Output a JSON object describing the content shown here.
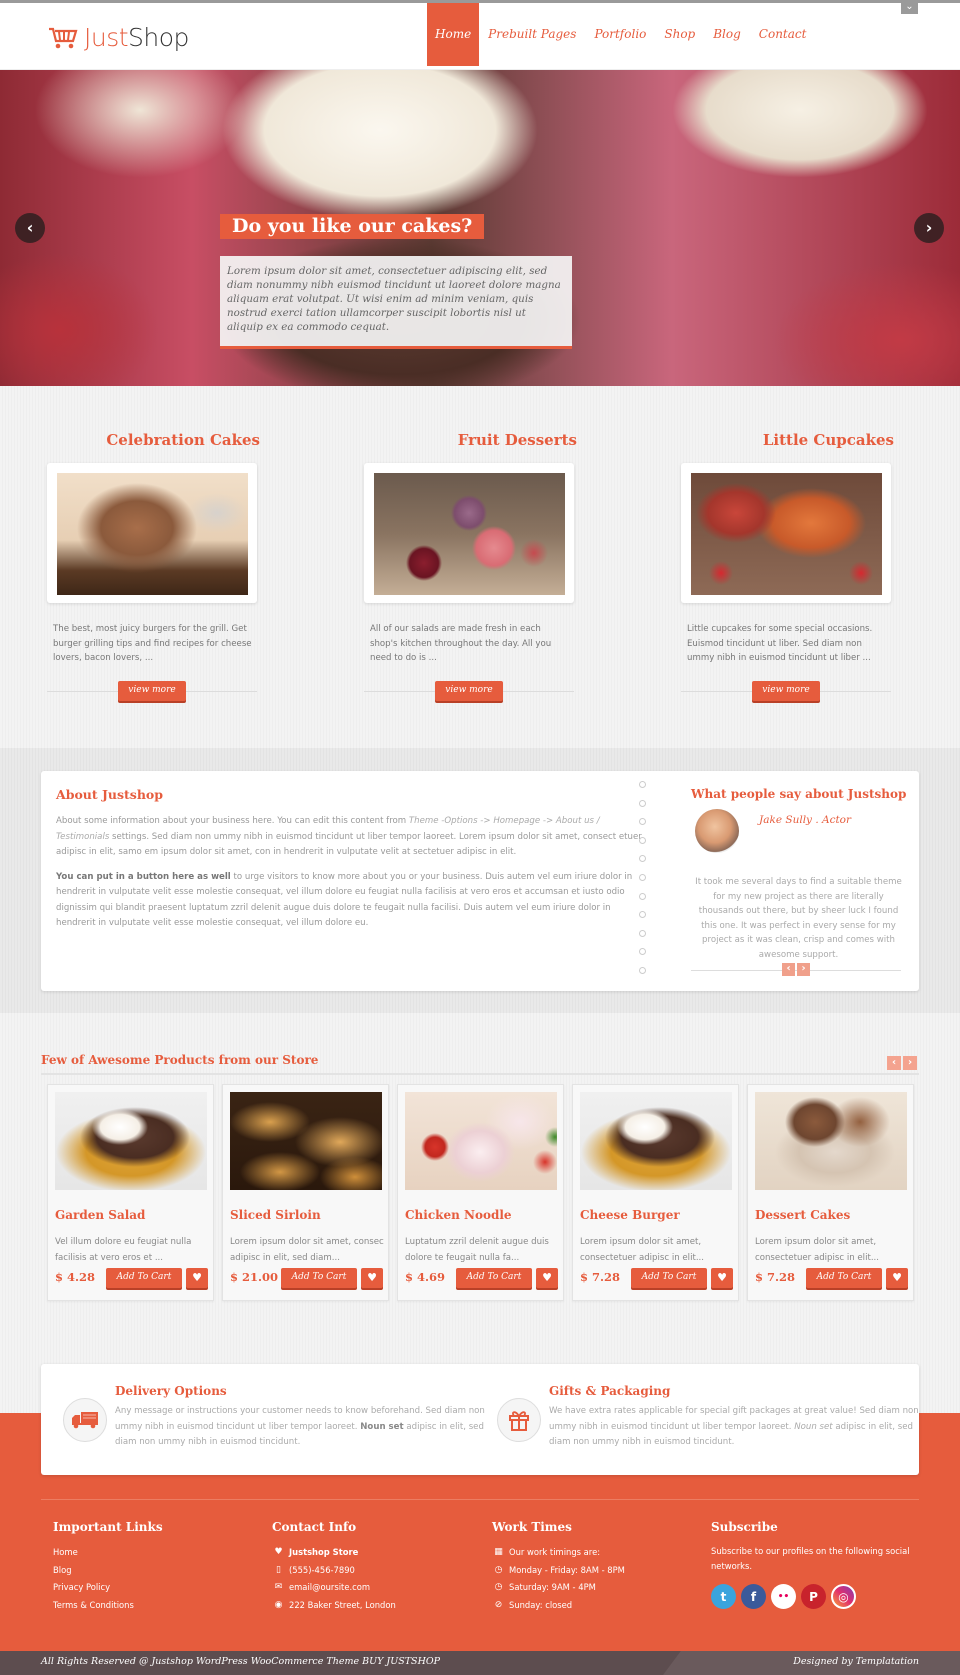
{
  "header": {
    "logo": {
      "part1": "Just",
      "part2": "Shop"
    },
    "nav": [
      {
        "label": "Home",
        "active": true
      },
      {
        "label": "Prebuilt Pages",
        "active": false
      },
      {
        "label": "Portfolio",
        "active": false
      },
      {
        "label": "Shop",
        "active": false
      },
      {
        "label": "Blog",
        "active": false
      },
      {
        "label": "Contact",
        "active": false
      }
    ],
    "toggle_icon": "chevron-down-icon"
  },
  "hero": {
    "title": "Do you like our cakes?",
    "text": "Lorem ipsum dolor sit amet, consectetuer adipiscing elit, sed diam nonummy nibh euismod tincidunt ut laoreet dolore magna aliquam erat volutpat. Ut wisi enim ad minim veniam, quis nostrud exerci tation ullamcorper suscipit lobortis nisl ut aliquip ex ea commodo cequat.",
    "prev_icon": "‹",
    "next_icon": "›"
  },
  "features": [
    {
      "title": "Celebration Cakes",
      "text": "The best, most juicy burgers for the grill. Get burger grilling tips and find recipes for cheese lovers, bacon lovers, ...",
      "button": "view more"
    },
    {
      "title": "Fruit Desserts",
      "text": "All of our salads are made fresh in each shop's kitchen throughout the day. All you need to do is ...",
      "button": "view more"
    },
    {
      "title": "Little Cupcakes",
      "text": "Little cupcakes for some special occasions. Euismod tincidunt ut liber. Sed diam non ummy nibh in euismod tincidunt ut liber ...",
      "button": "view more"
    }
  ],
  "about": {
    "title": "About Justshop",
    "p1_start": "About some information about your business here. You can edit this content from ",
    "p1_italic": "Theme -Options -> Homepage -> About us / Testimonials",
    "p1_end": " settings. Sed diam non ummy nibh in euismod tincidunt ut liber tempor laoreet. Lorem ipsum dolor sit amet, consect etuer adipisc in elit, samo em ipsum dolor sit amet, con in hendrerit in vulputate velit at sectetuer adipisc in elit.",
    "p2_bold": "You can put in a button here as well",
    "p2_rest": " to urge visitors to know more about you or your business. Duis autem vel eum iriure dolor in hendrerit in vulputate velit esse molestie consequat, vel illum dolore eu feugiat nulla facilisis at vero eros et accumsan et iusto odio dignissim qui blandit praesent luptatum zzril delenit augue duis dolore te feugait nulla facilisi. Duis autem vel eum iriure dolor in hendrerit in vulputate velit esse molestie consequat, vel illum dolore eu."
  },
  "testimonial": {
    "title": "What people say about Justshop",
    "name": "Jake Sully . Actor",
    "quote": "It took me several days to find a suitable theme for my new project as there are literally thousands out there, but by sheer luck I found this one. It was perfect in every sense for my project as it was clean, crisp and comes with awesome support.",
    "prev": "‹",
    "next": "›"
  },
  "products": {
    "title": "Few of Awesome Products from our Store",
    "prev": "‹",
    "next": "›",
    "items": [
      {
        "name": "Garden Salad",
        "desc": "Vel illum dolore eu feugiat nulla facilisis at vero eros et ...",
        "price": "$ 4.28",
        "button": "Add To Cart"
      },
      {
        "name": "Sliced Sirloin",
        "desc": "Lorem ipsum dolor sit amet, consec adipisc in elit, sed diam...",
        "price": "$ 21.00",
        "button": "Add To Cart"
      },
      {
        "name": "Chicken Noodle",
        "desc": "Luptatum zzril delenit augue duis dolore te feugait nulla fa...",
        "price": "$ 4.69",
        "button": "Add To Cart"
      },
      {
        "name": "Cheese Burger",
        "desc": "Lorem ipsum dolor sit amet, consectetuer adipisc in elit...",
        "price": "$ 7.28",
        "button": "Add To Cart"
      },
      {
        "name": "Dessert Cakes",
        "desc": "Lorem ipsum dolor sit amet, consectetuer adipisc in elit...",
        "price": "$ 7.28",
        "button": "Add To Cart"
      }
    ]
  },
  "info": {
    "delivery": {
      "title": "Delivery Options",
      "text_start": "Any message or instructions your customer needs to know beforehand. Sed diam non ummy nibh in euismod tincidunt ut liber tempor laoreet. ",
      "text_bold": "Noun set",
      "text_end": " adipisc in elit, sed diam non ummy nibh in euismod tincidunt."
    },
    "gifts": {
      "title": "Gifts & Packaging",
      "text_start": "We have extra rates applicable for special gift packages at great value! Sed diam non ummy nibh in euismod tincidunt ut liber tempor laoreet. ",
      "text_italic": "Noun set",
      "text_end": " adipisc in elit, sed diam non ummy nibh in euismod tincidunt."
    }
  },
  "footer": {
    "links": {
      "title": "Important Links",
      "items": [
        "Home",
        "Blog",
        "Privacy Policy",
        "Terms & Conditions"
      ]
    },
    "contact": {
      "title": "Contact Info",
      "store": "Justshop Store",
      "phone": "(555)-456-7890",
      "email": "email@oursite.com",
      "address": "222 Baker Street, London"
    },
    "work": {
      "title": "Work Times",
      "intro": "Our work timings are:",
      "weekdays": "Monday - Friday: 8AM - 8PM",
      "saturday": "Saturday: 9AM - 4PM",
      "sunday": "Sunday: closed"
    },
    "subscribe": {
      "title": "Subscribe",
      "text": "Subscribe to our profiles on the following social networks.",
      "networks": [
        {
          "name": "twitter",
          "glyph": "t",
          "color": "#3aa4dd"
        },
        {
          "name": "facebook",
          "glyph": "f",
          "color": "#3b5a9a"
        },
        {
          "name": "flickr",
          "glyph": "••",
          "color": "#ffffff"
        },
        {
          "name": "pinterest",
          "glyph": "P",
          "color": "#c8232c"
        },
        {
          "name": "instagram",
          "glyph": "◎",
          "color": "#d6336c"
        }
      ]
    },
    "copyright": "All Rights Reserved @ Justshop WordPress WooCommerce Theme BUY JUSTSHOP",
    "designed_by": "Designed by Templatation"
  },
  "colors": {
    "accent": "#e65c3d",
    "footer_bar": "#5d4d4f"
  }
}
